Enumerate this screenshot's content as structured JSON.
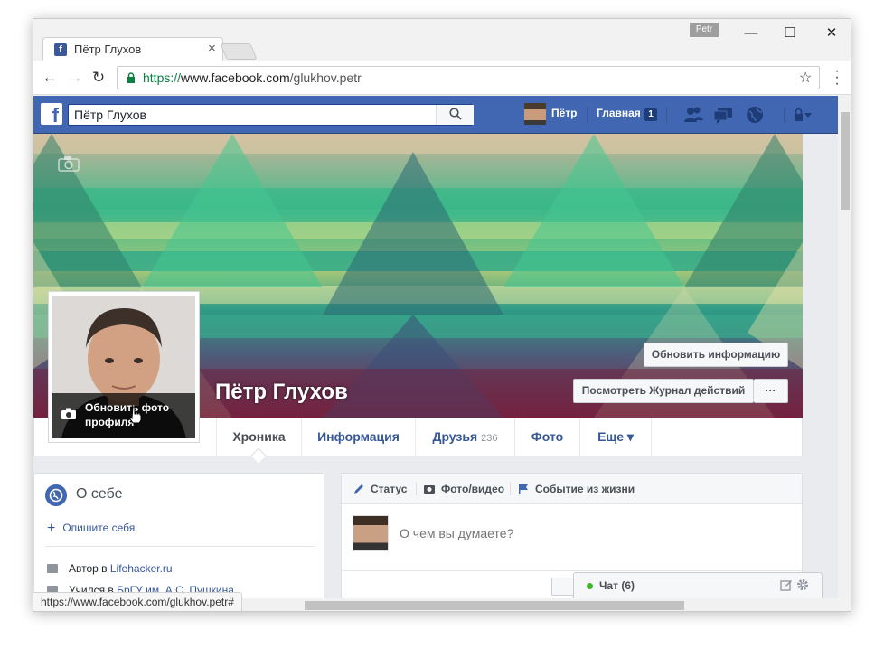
{
  "browser": {
    "tab_title": "Пётр Глухов",
    "tab_close": "×",
    "user_badge": "Petr",
    "url_scheme": "https://",
    "url_host": "www.facebook.com",
    "url_path": "/glukhov.petr",
    "status_url": "https://www.facebook.com/glukhov.petr#",
    "win_minimize": "—",
    "win_maximize": "☐",
    "win_close": "✕",
    "nav_back": "←",
    "nav_forward": "→",
    "nav_reload": "↻",
    "bookmark_star": "☆"
  },
  "fb_header": {
    "logo": "f",
    "search_value": "Пётр Глухов",
    "user_name": "Пётр",
    "home_label": "Главная",
    "home_badge": "1"
  },
  "profile": {
    "name": "Пётр Глухов",
    "update_info_button": "Обновить информацию",
    "activity_log_button": "Посмотреть Журнал действий",
    "more_button": "···",
    "update_photo_label": "Обновить фото профиля"
  },
  "timeline_tabs": [
    {
      "label": "Хроника"
    },
    {
      "label": "Информация"
    },
    {
      "label": "Друзья",
      "count": "236"
    },
    {
      "label": "Фото"
    },
    {
      "label": "Еще ▾"
    }
  ],
  "intro": {
    "title": "О себе",
    "add_bio": "Опишите себя",
    "work_prefix": "Автор в ",
    "work_link": "Lifehacker.ru",
    "study_prefix": "Учился в ",
    "study_link": "БрГУ им. А.С. Пушкина"
  },
  "composer": {
    "tab_status": "Статус",
    "tab_photo": "Фото/видео",
    "tab_event": "Событие из жизни",
    "placeholder": "О чем вы думаете?"
  },
  "chat": {
    "label": "Чат (6)"
  },
  "colors": {
    "fb_blue": "#4267b2",
    "link_blue": "#365899",
    "online_green": "#42b72a"
  },
  "icons": [
    "facebook-tab-icon",
    "lock-icon",
    "star-icon",
    "search-icon",
    "friends-icon",
    "messages-icon",
    "globe-icon",
    "lock-settings-icon",
    "camera-icon",
    "pencil-icon",
    "flag-icon",
    "briefcase-icon",
    "graduation-icon",
    "compose-icon",
    "gear-icon"
  ]
}
